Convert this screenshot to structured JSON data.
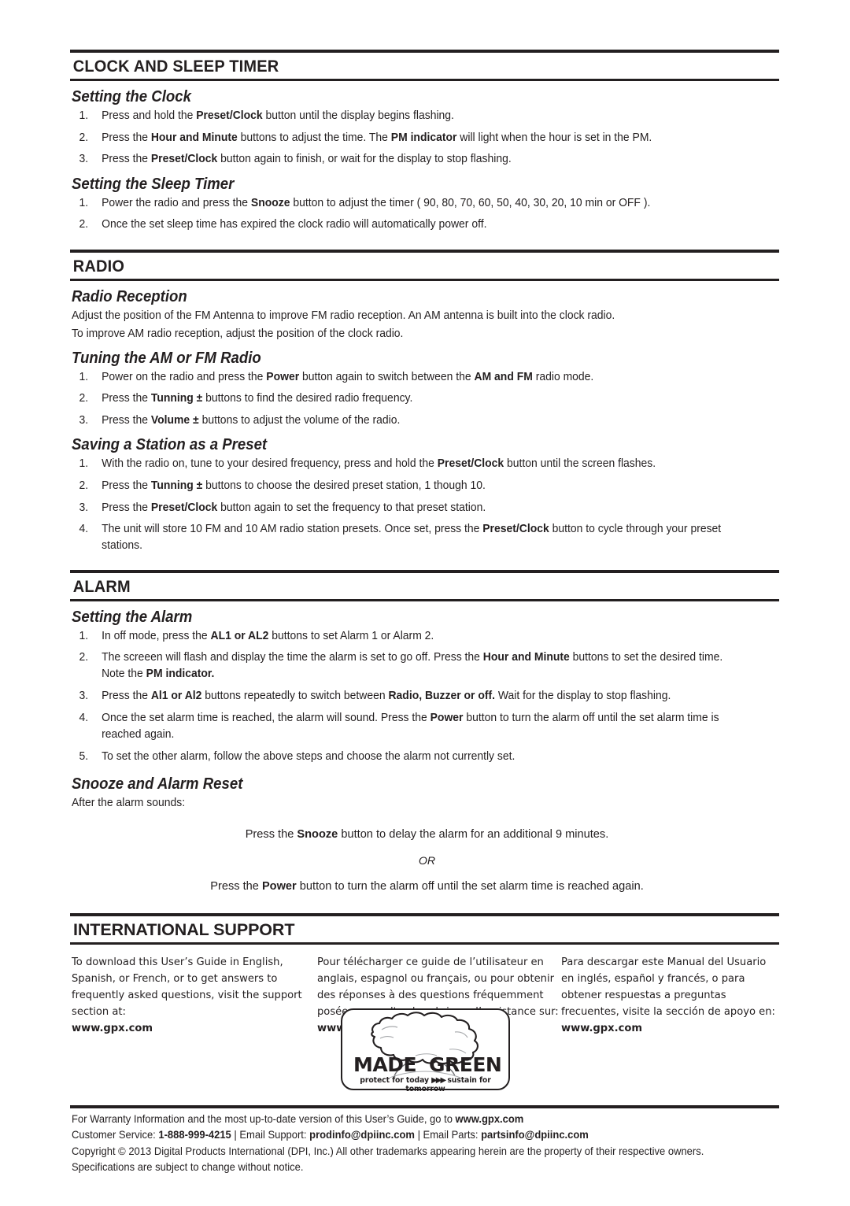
{
  "sections": [
    {
      "id": "clock-and-sleep-timer",
      "title": "CLOCK AND SLEEP TIMER",
      "subsections": [
        {
          "heading": "Setting the Clock",
          "steps": [
            "Press and hold the <b>Preset/Clock</b> button until the display begins flashing.",
            "Press the <b>Hour and Minute</b> buttons to adjust the time. The <b>PM indicator</b> will light when the hour is set in the PM.",
            "Press the <b>Preset/Clock</b> button again to finish, or wait for the display to stop flashing."
          ]
        },
        {
          "heading": "Setting the Sleep Timer",
          "steps": [
            "Power the radio and press the <b>Snooze</b> button to adjust the timer ( 90, 80, 70, 60, 50, 40, 30, 20, 10 min or OFF ).",
            "Once the set sleep time has expired the clock radio will automatically power off."
          ]
        }
      ]
    },
    {
      "id": "radio",
      "title": "RADIO",
      "subsections": [
        {
          "heading": "Radio Reception",
          "paragraphs": [
            "Adjust the position of the FM Antenna to improve FM radio reception. An AM antenna is built into the clock radio.",
            "To improve AM radio reception, adjust the position of the clock radio."
          ]
        },
        {
          "heading": "Tuning the AM or FM Radio",
          "steps": [
            "Power on the radio and press the <b>Power</b> button again to switch between the <b>AM and FM</b> radio mode.",
            "Press the <b>Tunning &plusmn;</b> buttons to find the desired radio frequency.",
            "Press the <b>Volume &plusmn;</b> buttons to adjust the volume of the radio."
          ]
        },
        {
          "heading": "Saving a Station as a Preset",
          "steps": [
            "With the radio on, tune to your desired frequency, press and hold the <b>Preset/Clock</b> button until the screen flashes.",
            "Press the <b>Tunning &plusmn;</b> buttons to choose the desired preset station, 1 though 10.",
            "Press the <b>Preset/Clock</b> button again to set the frequency to that preset station.",
            "The unit will store 10 FM and 10 AM radio station presets. Once set, press the <b>Preset/Clock</b> button to cycle through your preset stations."
          ]
        }
      ]
    },
    {
      "id": "alarm",
      "title": "ALARM",
      "subsections": [
        {
          "heading": "Setting the Alarm",
          "steps": [
            "In off mode, press the <b>AL1 or AL2</b> buttons to set Alarm 1 or Alarm 2.",
            "The screeen will flash and display the time the alarm is set to go off. Press the <b>Hour and Minute</b> buttons to set the desired time. Note the <b>PM indicator.</b>",
            "Press the <b>Al1 or Al2</b> buttons repeatedly to switch between <b>Radio, Buzzer or off.</b> Wait for the display to stop flashing.",
            "Once the set alarm time is reached, the alarm will sound. Press the <b>Power</b> button to turn the alarm off until the set alarm time is reached again.",
            "To set the other alarm, follow the above steps and choose the alarm not currently set."
          ]
        },
        {
          "heading": "Snooze and Alarm Reset",
          "intro": "After the alarm sounds:",
          "centered": [
            "Press the <b>Snooze</b> button to delay the alarm for an additional 9 minutes.",
            "OR",
            "Press the <b>Power</b> button to turn the alarm off until the set alarm time is reached again."
          ]
        }
      ]
    },
    {
      "id": "international-support",
      "title": "INTERNATIONAL SUPPORT"
    }
  ],
  "international_support": {
    "title": "INTERNATIONAL SUPPORT",
    "columns": [
      {
        "lang": "english",
        "text": "To download this User&rsquo;s Guide in English, Spanish, or French, or to get answers to frequently asked questions, visit the support section  at:<br><b>www.gpx.com</b>"
      },
      {
        "lang": "french",
        "text": "Pour t&eacute;l&eacute;charger ce guide de l&rsquo;utilisateur en anglais, espagnol ou fran&ccedil;ais, ou pour obtenir des r&eacute;ponses &agrave; des questions fr&eacute;quemment pos&eacute;es, consultez la rubrique d&rsquo;assistance sur:<br><b>www.gpx.com</b>"
      },
      {
        "lang": "spanish",
        "text": "Para descargar este Manual del Usuario en ingl&eacute;s, espa&ntilde;ol y franc&eacute;s, o para obtener respuestas a preguntas frecuentes, visite la secci&oacute;n de apoyo en: <b>www.gpx.com</b>"
      }
    ]
  },
  "logo": {
    "made": "MADE",
    "green": "GREEN",
    "tagline_left": "protect for today",
    "tagline_arrows": "▶▶▶",
    "tagline_right": "sustain for tomorrow"
  },
  "footer": {
    "line1": "For Warranty Information and the most up-to-date version of this User&rsquo;s Guide, go to <b>www.gpx.com</b>",
    "line2": "Customer Service: <b>1-888-999-4215</b> | Email Support: <b>prodinfo@dpiinc.com</b> | Email Parts: <b>partsinfo@dpiinc.com</b>",
    "line3": "Copyright &copy; 2013 Digital Products International (DPI, Inc.) All other trademarks appearing herein are the property of their respective owners.",
    "line4": "Specifications are subject to change without notice."
  },
  "colors": {
    "ink": "#231f20",
    "background": "#ffffff"
  }
}
